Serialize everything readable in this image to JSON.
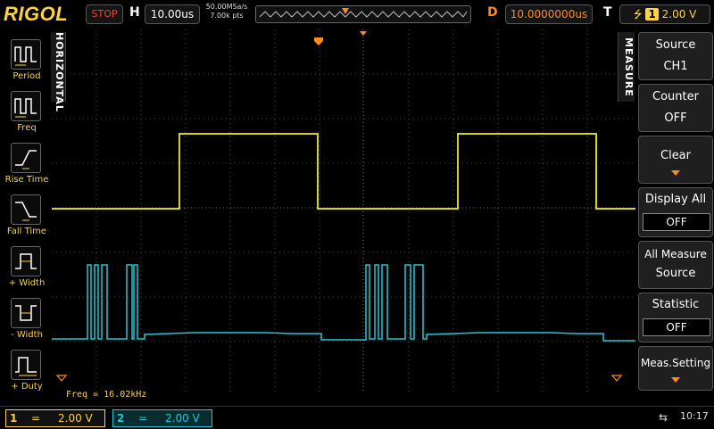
{
  "top": {
    "brand": "RIGOL",
    "run_state": "STOP",
    "h_label": "H",
    "timebase": "10.00us",
    "sample_rate": "50.00MSa/s",
    "memory": "7.00k pts",
    "d_label": "D",
    "delay": "10.0000000us",
    "t_label": "T",
    "trigger_channel": "1",
    "trigger_level": "2.00 V"
  },
  "left_menu": {
    "tab_label": "HORIZONTAL",
    "items": [
      {
        "label": "Period"
      },
      {
        "label": "Freq"
      },
      {
        "label": "Rise Time"
      },
      {
        "label": "Fall Time"
      },
      {
        "label": "+ Width"
      },
      {
        "label": "- Width"
      },
      {
        "label": "+ Duty"
      }
    ]
  },
  "right_menu": {
    "tab_label": "MEASURE",
    "source_title": "Source",
    "source_value": "CH1",
    "counter_title": "Counter",
    "counter_value": "OFF",
    "clear_title": "Clear",
    "display_all_title": "Display All",
    "display_all_value": "OFF",
    "all_measure_line1": "All Measure",
    "all_measure_line2": "Source",
    "statistic_title": "Statistic",
    "statistic_value": "OFF",
    "meas_setting_title": "Meas.Setting"
  },
  "measurement": "Freq = 16.02kHz",
  "bottom": {
    "ch1_num": "1",
    "ch1_coupling": "=",
    "ch1_scale": "2.00 V",
    "ch2_num": "2",
    "ch2_coupling": "=",
    "ch2_scale": "2.00 V",
    "usb_symbol": "⇆",
    "time": "10:17"
  },
  "colors": {
    "ch1": "#d9d21a",
    "ch2": "#22c7d6",
    "accent": "#ff8c1a",
    "grid": "#555555"
  }
}
